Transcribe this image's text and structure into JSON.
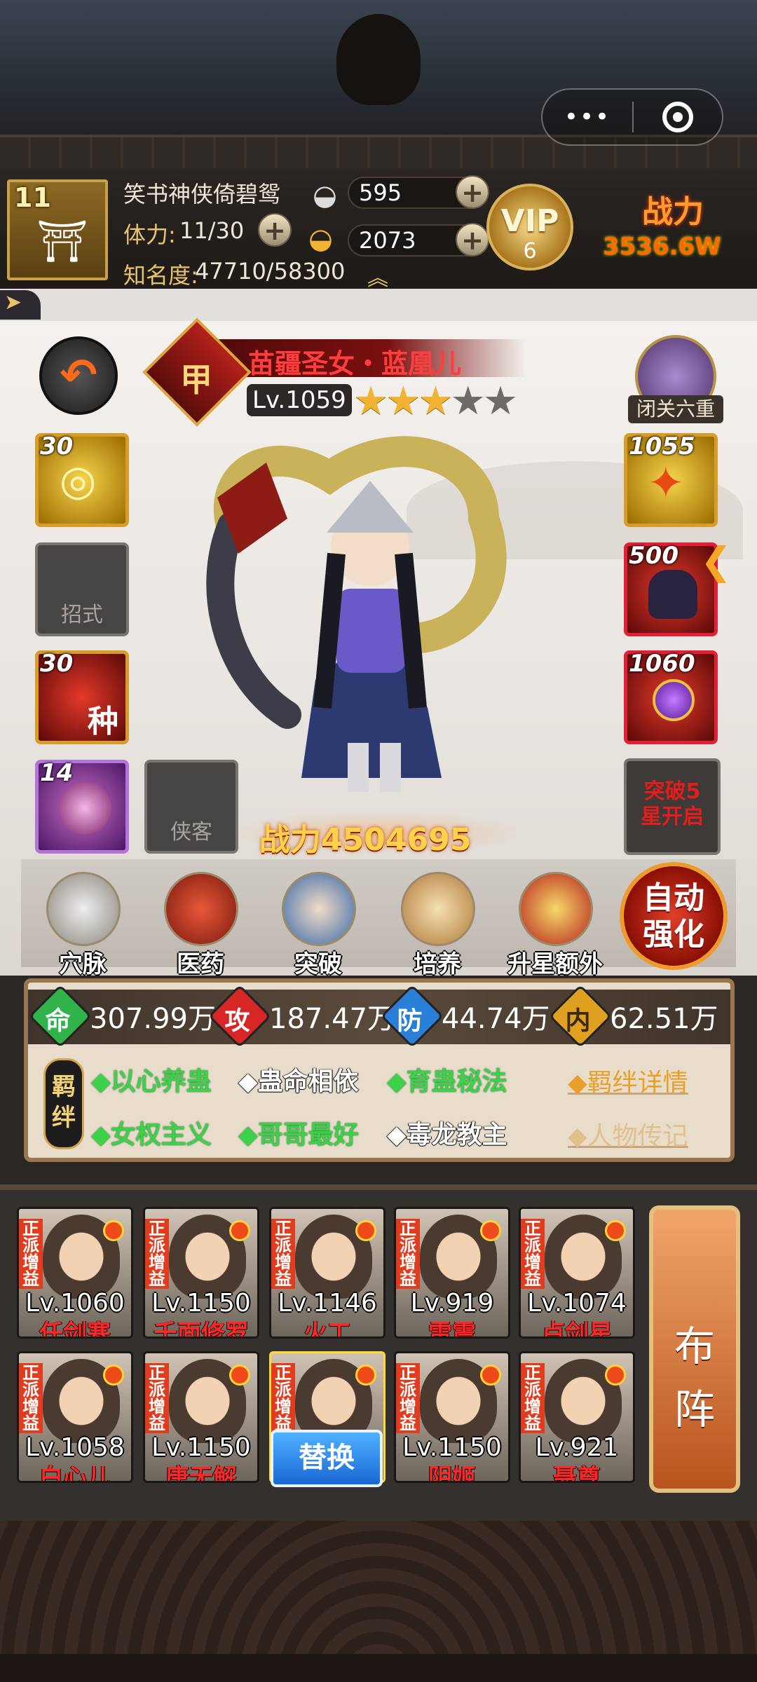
{
  "top": {
    "menu_icon": "ellipsis-icon",
    "close_icon": "target-icon"
  },
  "player": {
    "level": "11",
    "name": "笑书神侠倚碧鸳",
    "stamina_label": "体力:",
    "stamina": "11/30",
    "fame_label": "知名度:",
    "fame": "47710/58300",
    "silver": "595",
    "gold": "2073",
    "vip_label": "VIP",
    "vip_level": "6",
    "power_label": "战力",
    "power_value": "3536.6W"
  },
  "hero": {
    "rank": "甲",
    "name": "苗疆圣女・蓝凰儿",
    "level": "Lv.1059",
    "stars_on": 3,
    "stars_total": 5,
    "closed_label": "闭关六重",
    "power": "战力4504695",
    "breakthrough": "突破5\n星开启"
  },
  "left_slots": [
    {
      "num": "30",
      "type": "gold",
      "icon": "swirl-skill-icon"
    },
    {
      "num": "",
      "type": "empty",
      "label": "招式"
    },
    {
      "num": "30",
      "type": "red",
      "icon": "poison-skill-icon",
      "glyph": "种"
    },
    {
      "num": "14",
      "type": "purple",
      "icon": "orb-skill-icon"
    }
  ],
  "companion_slot": {
    "label": "侠客"
  },
  "right_slots": [
    {
      "num": "1055",
      "type": "gold",
      "icon": "golden-bee-icon"
    },
    {
      "num": "500",
      "type": "red",
      "icon": "dark-armor-icon"
    },
    {
      "num": "1060",
      "type": "red",
      "icon": "purple-urn-icon"
    }
  ],
  "functions": [
    {
      "label": "穴脉",
      "icon": "meridian-icon"
    },
    {
      "label": "医药",
      "icon": "herb-icon"
    },
    {
      "label": "突破",
      "icon": "breakthrough-icon"
    },
    {
      "label": "培养",
      "icon": "scroll-icon"
    },
    {
      "label": "升星额外",
      "icon": "star-up-icon"
    }
  ],
  "auto_label": "自动强化",
  "stats": [
    {
      "key": "命",
      "value": "307.99万",
      "color": "#2fb34a"
    },
    {
      "key": "攻",
      "value": "187.47万",
      "color": "#d72626"
    },
    {
      "key": "防",
      "value": "44.74万",
      "color": "#2a7fd6"
    },
    {
      "key": "内",
      "value": "62.51万",
      "color": "#e0a020"
    }
  ],
  "bond_tag": "羁绊",
  "bonds_row1": [
    {
      "text": "◆以心养蛊",
      "active": true
    },
    {
      "text": "◆蛊命相依",
      "active": false
    },
    {
      "text": "◆育蛊秘法",
      "active": true
    }
  ],
  "bonds_row2": [
    {
      "text": "◆女权主义",
      "active": true
    },
    {
      "text": "◆哥哥最好",
      "active": true
    },
    {
      "text": "◆毒龙教主",
      "active": false
    }
  ],
  "links": {
    "bond_detail": "◆羁绊详情",
    "biography": "◆人物传记"
  },
  "roster_tag": "正派增益",
  "roster": [
    {
      "level": "Lv.1060",
      "name": "任剑寒"
    },
    {
      "level": "Lv.1150",
      "name": "千面修罗"
    },
    {
      "level": "Lv.1146",
      "name": "火工"
    },
    {
      "level": "Lv.919",
      "name": "雷震"
    },
    {
      "level": "Lv.1074",
      "name": "卢剑星"
    },
    {
      "level": "Lv.1058",
      "name": "白心儿"
    },
    {
      "level": "Lv.1150",
      "name": "唐无解"
    },
    {
      "level": "",
      "name": ""
    },
    {
      "level": "Lv.1150",
      "name": "阴姬"
    },
    {
      "level": "Lv.921",
      "name": "聂尊"
    }
  ],
  "replace_label": "替换",
  "formation_label": "布阵"
}
